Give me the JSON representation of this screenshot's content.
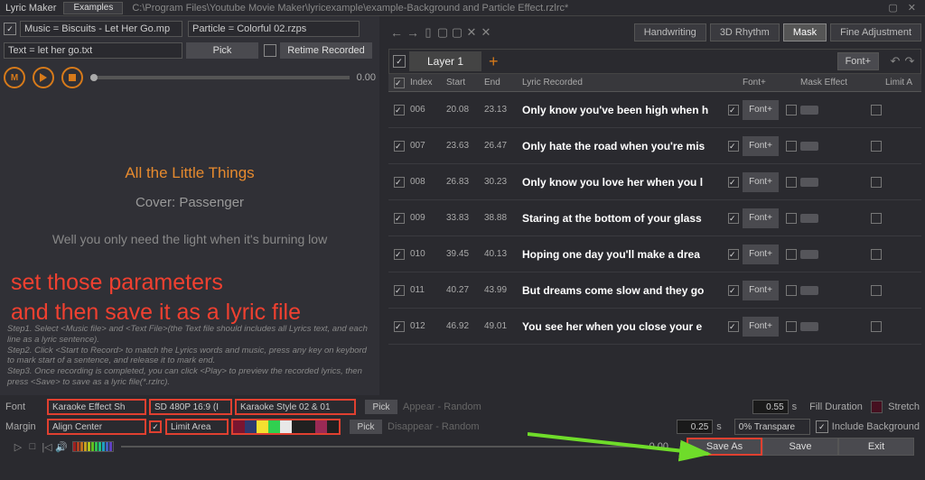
{
  "titlebar": {
    "app": "Lyric Maker",
    "examples": "Examples",
    "path": "C:\\Program Files\\Youtube Movie Maker\\lyricexample\\example-Background and Particle Effect.rzlrc*"
  },
  "leftPane": {
    "musicField": "Music = Biscuits - Let Her Go.mp",
    "particleField": "Particle = Colorful 02.rzps",
    "textField": "Text = let her go.txt",
    "pick": "Pick",
    "retime": "Retime Recorded",
    "mLabel": "M",
    "time": "0.00",
    "previewTitle": "All the Little Things",
    "previewSub": "Cover: Passenger",
    "previewLine": "Well you only need the light when it's burning low",
    "steps": {
      "s1": "Step1. Select <Music file> and <Text File>(the Text file should includes all Lyrics text, and each line as a lyric sentence).",
      "s2": "Step2. Click <Start to Record> to match the Lyrics words and music, press any key on keybord to mark start of a sentence, and release it to mark end.",
      "s3": "Step3. Once recording is completed, you can click <Play> to preview the recorded lyrics, then press <Save> to save as a lyric file(*.rzlrc)."
    }
  },
  "overlay": {
    "l1": "set those parameters",
    "l2": "and then save it as a lyric file"
  },
  "rightPane": {
    "btns": {
      "hand": "Handwriting",
      "rhythm": "3D Rhythm",
      "mask": "Mask",
      "fine": "Fine Adjustment"
    },
    "layer": "Layer 1",
    "fontPlus": "Font+",
    "headers": {
      "index": "Index",
      "start": "Start",
      "end": "End",
      "lyric": "Lyric Recorded",
      "font": "Font+",
      "mask": "Mask Effect",
      "limit": "Limit A"
    },
    "rows": [
      {
        "idx": "006",
        "start": "20.08",
        "end": "23.13",
        "lyric": "Only know you've been high when h"
      },
      {
        "idx": "007",
        "start": "23.63",
        "end": "26.47",
        "lyric": "Only hate the road when you're mis"
      },
      {
        "idx": "008",
        "start": "26.83",
        "end": "30.23",
        "lyric": "Only know you love her when you l"
      },
      {
        "idx": "009",
        "start": "33.83",
        "end": "38.88",
        "lyric": "Staring at the bottom of your glass"
      },
      {
        "idx": "010",
        "start": "39.45",
        "end": "40.13",
        "lyric": "Hoping one day you'll make a drea"
      },
      {
        "idx": "011",
        "start": "40.27",
        "end": "43.99",
        "lyric": "But dreams come slow and they go"
      },
      {
        "idx": "012",
        "start": "46.92",
        "end": "49.01",
        "lyric": "You see her when you close your e"
      }
    ]
  },
  "bottom": {
    "font": "Font",
    "margin": "Margin",
    "karaokeEffect": "Karaoke Effect Sh",
    "resolution": "SD 480P 16:9 (I",
    "karaokeStyle": "Karaoke Style 02 & 01",
    "alignCenter": "Align Center",
    "limitArea": "Limit Area",
    "pick": "Pick",
    "appear": "Appear - Random",
    "disappear": "Disappear - Random",
    "val1": "0.55",
    "val2": "0.25",
    "sec": "s",
    "fillDur": "Fill Duration",
    "stretch": "Stretch",
    "transparent": "0% Transpare",
    "includeBg": "Include Background",
    "playbarTime": "0.00",
    "saveAs": "Save As",
    "save": "Save",
    "exit": "Exit",
    "swatches": [
      "#7a1530",
      "#2e3a6e",
      "#f5e030",
      "#30d050",
      "#e8e8e8",
      "#202020",
      "#202020",
      "#9a2a55",
      "#202020"
    ]
  }
}
